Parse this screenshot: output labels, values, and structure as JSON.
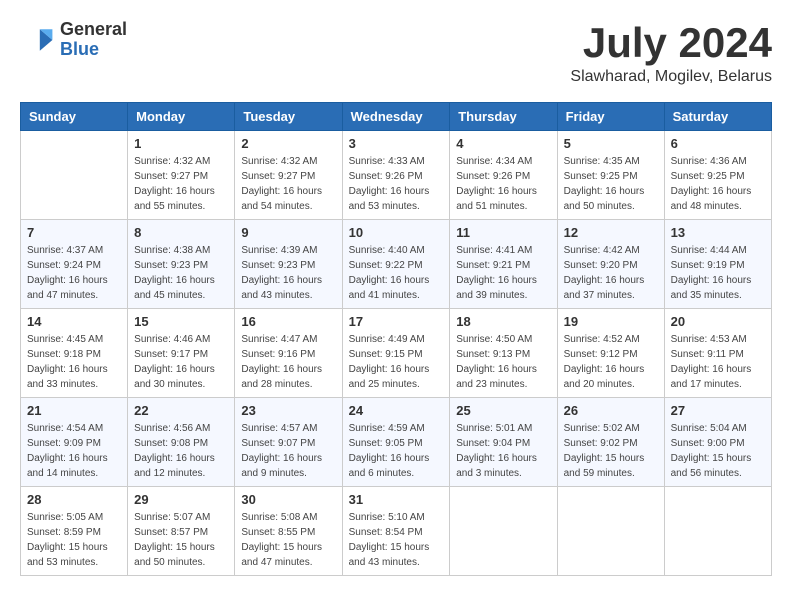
{
  "header": {
    "logo_general": "General",
    "logo_blue": "Blue",
    "month_title": "July 2024",
    "location": "Slawharad, Mogilev, Belarus"
  },
  "days": [
    "Sunday",
    "Monday",
    "Tuesday",
    "Wednesday",
    "Thursday",
    "Friday",
    "Saturday"
  ],
  "weeks": [
    [
      {
        "num": "",
        "sunrise": "",
        "sunset": "",
        "daylight": ""
      },
      {
        "num": "1",
        "sunrise": "Sunrise: 4:32 AM",
        "sunset": "Sunset: 9:27 PM",
        "daylight": "Daylight: 16 hours and 55 minutes."
      },
      {
        "num": "2",
        "sunrise": "Sunrise: 4:32 AM",
        "sunset": "Sunset: 9:27 PM",
        "daylight": "Daylight: 16 hours and 54 minutes."
      },
      {
        "num": "3",
        "sunrise": "Sunrise: 4:33 AM",
        "sunset": "Sunset: 9:26 PM",
        "daylight": "Daylight: 16 hours and 53 minutes."
      },
      {
        "num": "4",
        "sunrise": "Sunrise: 4:34 AM",
        "sunset": "Sunset: 9:26 PM",
        "daylight": "Daylight: 16 hours and 51 minutes."
      },
      {
        "num": "5",
        "sunrise": "Sunrise: 4:35 AM",
        "sunset": "Sunset: 9:25 PM",
        "daylight": "Daylight: 16 hours and 50 minutes."
      },
      {
        "num": "6",
        "sunrise": "Sunrise: 4:36 AM",
        "sunset": "Sunset: 9:25 PM",
        "daylight": "Daylight: 16 hours and 48 minutes."
      }
    ],
    [
      {
        "num": "7",
        "sunrise": "Sunrise: 4:37 AM",
        "sunset": "Sunset: 9:24 PM",
        "daylight": "Daylight: 16 hours and 47 minutes."
      },
      {
        "num": "8",
        "sunrise": "Sunrise: 4:38 AM",
        "sunset": "Sunset: 9:23 PM",
        "daylight": "Daylight: 16 hours and 45 minutes."
      },
      {
        "num": "9",
        "sunrise": "Sunrise: 4:39 AM",
        "sunset": "Sunset: 9:23 PM",
        "daylight": "Daylight: 16 hours and 43 minutes."
      },
      {
        "num": "10",
        "sunrise": "Sunrise: 4:40 AM",
        "sunset": "Sunset: 9:22 PM",
        "daylight": "Daylight: 16 hours and 41 minutes."
      },
      {
        "num": "11",
        "sunrise": "Sunrise: 4:41 AM",
        "sunset": "Sunset: 9:21 PM",
        "daylight": "Daylight: 16 hours and 39 minutes."
      },
      {
        "num": "12",
        "sunrise": "Sunrise: 4:42 AM",
        "sunset": "Sunset: 9:20 PM",
        "daylight": "Daylight: 16 hours and 37 minutes."
      },
      {
        "num": "13",
        "sunrise": "Sunrise: 4:44 AM",
        "sunset": "Sunset: 9:19 PM",
        "daylight": "Daylight: 16 hours and 35 minutes."
      }
    ],
    [
      {
        "num": "14",
        "sunrise": "Sunrise: 4:45 AM",
        "sunset": "Sunset: 9:18 PM",
        "daylight": "Daylight: 16 hours and 33 minutes."
      },
      {
        "num": "15",
        "sunrise": "Sunrise: 4:46 AM",
        "sunset": "Sunset: 9:17 PM",
        "daylight": "Daylight: 16 hours and 30 minutes."
      },
      {
        "num": "16",
        "sunrise": "Sunrise: 4:47 AM",
        "sunset": "Sunset: 9:16 PM",
        "daylight": "Daylight: 16 hours and 28 minutes."
      },
      {
        "num": "17",
        "sunrise": "Sunrise: 4:49 AM",
        "sunset": "Sunset: 9:15 PM",
        "daylight": "Daylight: 16 hours and 25 minutes."
      },
      {
        "num": "18",
        "sunrise": "Sunrise: 4:50 AM",
        "sunset": "Sunset: 9:13 PM",
        "daylight": "Daylight: 16 hours and 23 minutes."
      },
      {
        "num": "19",
        "sunrise": "Sunrise: 4:52 AM",
        "sunset": "Sunset: 9:12 PM",
        "daylight": "Daylight: 16 hours and 20 minutes."
      },
      {
        "num": "20",
        "sunrise": "Sunrise: 4:53 AM",
        "sunset": "Sunset: 9:11 PM",
        "daylight": "Daylight: 16 hours and 17 minutes."
      }
    ],
    [
      {
        "num": "21",
        "sunrise": "Sunrise: 4:54 AM",
        "sunset": "Sunset: 9:09 PM",
        "daylight": "Daylight: 16 hours and 14 minutes."
      },
      {
        "num": "22",
        "sunrise": "Sunrise: 4:56 AM",
        "sunset": "Sunset: 9:08 PM",
        "daylight": "Daylight: 16 hours and 12 minutes."
      },
      {
        "num": "23",
        "sunrise": "Sunrise: 4:57 AM",
        "sunset": "Sunset: 9:07 PM",
        "daylight": "Daylight: 16 hours and 9 minutes."
      },
      {
        "num": "24",
        "sunrise": "Sunrise: 4:59 AM",
        "sunset": "Sunset: 9:05 PM",
        "daylight": "Daylight: 16 hours and 6 minutes."
      },
      {
        "num": "25",
        "sunrise": "Sunrise: 5:01 AM",
        "sunset": "Sunset: 9:04 PM",
        "daylight": "Daylight: 16 hours and 3 minutes."
      },
      {
        "num": "26",
        "sunrise": "Sunrise: 5:02 AM",
        "sunset": "Sunset: 9:02 PM",
        "daylight": "Daylight: 15 hours and 59 minutes."
      },
      {
        "num": "27",
        "sunrise": "Sunrise: 5:04 AM",
        "sunset": "Sunset: 9:00 PM",
        "daylight": "Daylight: 15 hours and 56 minutes."
      }
    ],
    [
      {
        "num": "28",
        "sunrise": "Sunrise: 5:05 AM",
        "sunset": "Sunset: 8:59 PM",
        "daylight": "Daylight: 15 hours and 53 minutes."
      },
      {
        "num": "29",
        "sunrise": "Sunrise: 5:07 AM",
        "sunset": "Sunset: 8:57 PM",
        "daylight": "Daylight: 15 hours and 50 minutes."
      },
      {
        "num": "30",
        "sunrise": "Sunrise: 5:08 AM",
        "sunset": "Sunset: 8:55 PM",
        "daylight": "Daylight: 15 hours and 47 minutes."
      },
      {
        "num": "31",
        "sunrise": "Sunrise: 5:10 AM",
        "sunset": "Sunset: 8:54 PM",
        "daylight": "Daylight: 15 hours and 43 minutes."
      },
      {
        "num": "",
        "sunrise": "",
        "sunset": "",
        "daylight": ""
      },
      {
        "num": "",
        "sunrise": "",
        "sunset": "",
        "daylight": ""
      },
      {
        "num": "",
        "sunrise": "",
        "sunset": "",
        "daylight": ""
      }
    ]
  ]
}
